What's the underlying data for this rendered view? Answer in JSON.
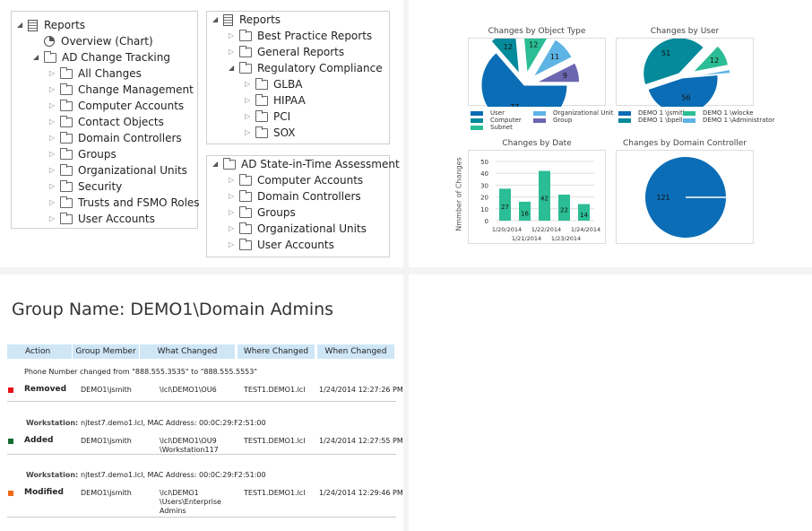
{
  "tree_main": {
    "items": [
      {
        "label": "Reports",
        "type": "report",
        "expanded": true,
        "level": 0
      },
      {
        "label": "Overview (Chart)",
        "type": "chart",
        "level": 1
      },
      {
        "label": "AD Change Tracking",
        "type": "folder",
        "expanded": true,
        "level": 1
      },
      {
        "label": "All Changes",
        "type": "folder",
        "level": 2
      },
      {
        "label": "Change Management",
        "type": "folder",
        "level": 2
      },
      {
        "label": "Computer Accounts",
        "type": "folder",
        "level": 2
      },
      {
        "label": "Contact Objects",
        "type": "folder",
        "level": 2
      },
      {
        "label": "Domain Controllers",
        "type": "folder",
        "level": 2
      },
      {
        "label": "Groups",
        "type": "folder",
        "level": 2
      },
      {
        "label": "Organizational Units",
        "type": "folder",
        "level": 2
      },
      {
        "label": "Security",
        "type": "folder",
        "level": 2
      },
      {
        "label": "Trusts and FSMO Roles",
        "type": "folder",
        "level": 2
      },
      {
        "label": "User Accounts",
        "type": "folder",
        "level": 2
      }
    ]
  },
  "tree_reports": {
    "items": [
      {
        "label": "Reports",
        "type": "report",
        "expanded": true,
        "level": 0
      },
      {
        "label": "Best Practice Reports",
        "type": "folder",
        "level": 1
      },
      {
        "label": "General Reports",
        "type": "folder",
        "level": 1
      },
      {
        "label": "Regulatory Compliance",
        "type": "folder",
        "expanded": true,
        "level": 1
      },
      {
        "label": "GLBA",
        "type": "folder",
        "level": 2
      },
      {
        "label": "HIPAA",
        "type": "folder",
        "level": 2
      },
      {
        "label": "PCI",
        "type": "folder",
        "level": 2
      },
      {
        "label": "SOX",
        "type": "folder",
        "level": 2
      }
    ]
  },
  "tree_state": {
    "items": [
      {
        "label": "AD State-in-Time Assessment",
        "type": "folder",
        "expanded": true,
        "level": 0
      },
      {
        "label": "Computer Accounts",
        "type": "folder",
        "level": 1
      },
      {
        "label": "Domain Controllers",
        "type": "folder",
        "level": 1
      },
      {
        "label": "Groups",
        "type": "folder",
        "level": 1
      },
      {
        "label": "Organizational Units",
        "type": "folder",
        "level": 1
      },
      {
        "label": "User Accounts",
        "type": "folder",
        "level": 1
      }
    ]
  },
  "chart_data": [
    {
      "type": "pie",
      "title": "Changes by Object Type",
      "categories": [
        "User",
        "Computer",
        "Subnet",
        "Organizational Unit",
        "Group"
      ],
      "values": [
        77,
        12,
        12,
        11,
        9
      ],
      "colors": [
        "#0b6db5",
        "#048a9a",
        "#2bbd95",
        "#5db4e5",
        "#6b66b0"
      ],
      "legend": "bottom"
    },
    {
      "type": "pie",
      "title": "Changes by User",
      "categories": [
        "DEMO 1 \\jsmith",
        "DEMO 1 \\bpells",
        "DEMO 1 \\wlocke",
        "DEMO 1 \\Administrator"
      ],
      "values": [
        56,
        51,
        12,
        2
      ],
      "colors": [
        "#0b6db5",
        "#048a9a",
        "#2bbd95",
        "#5db4e5"
      ],
      "legend": "bottom"
    },
    {
      "type": "bar",
      "title": "Changes by Date",
      "ylabel": "Nmmber of Changes",
      "categories": [
        "1/20/2014",
        "1/21/2014",
        "1/22/2014",
        "1/23/2014",
        "1/24/2014"
      ],
      "values": [
        27,
        16,
        42,
        22,
        14
      ],
      "ylim": [
        0,
        50
      ],
      "yticks": [
        "0",
        "10",
        "20",
        "30",
        "40",
        "50"
      ],
      "grid": true,
      "color": "#2bbd95"
    },
    {
      "type": "pie",
      "title": "Changes by Domain Controller",
      "values": [
        121
      ],
      "colors": [
        "#0b6db5"
      ]
    }
  ],
  "report": {
    "title": "Group Name: DEMO1\\Domain Admins",
    "columns": [
      "Action",
      "Group Member",
      "What Changed",
      "Where Changed",
      "When Changed"
    ],
    "rows": [
      {
        "detail": "Phone Number changed from \"888.555.3535\" to \"888.555.5553\"",
        "action": "Removed",
        "color": "#e8101a",
        "member": "DEMO1\\jsmith",
        "what": [
          "\\lcl\\DEMO1\\OU6"
        ],
        "where": "TEST1.DEMO1.lcl",
        "when": "1/24/2014 12:27:26 PM"
      },
      {
        "detail_label": "Workstation:",
        "detail": "njtest7.demo1.lcl, MAC Address: 00:0C:29:F2:51:00",
        "action": "Added",
        "color": "#146b30",
        "member": "DEMO1\\jsmith",
        "what": [
          "\\lcl\\DEMO1\\OU9",
          "\\Workstation117"
        ],
        "where": "TEST1.DEMO1.lcl",
        "when": "1/24/2014 12:27:55 PM"
      },
      {
        "detail_label": "Workstation:",
        "detail": "njtest7.demo1.lcl, MAC Address: 00:0C:29:F2:51:00",
        "action": "Modified",
        "color": "#f06a1a",
        "member": "DEMO1\\jsmith",
        "what": [
          "\\lcl\\DEMO1",
          "\\Users\\Enterprise",
          "Admins"
        ],
        "where": "TEST1.DEMO1.lcl",
        "when": "1/24/2014 12:29:46 PM"
      }
    ]
  }
}
